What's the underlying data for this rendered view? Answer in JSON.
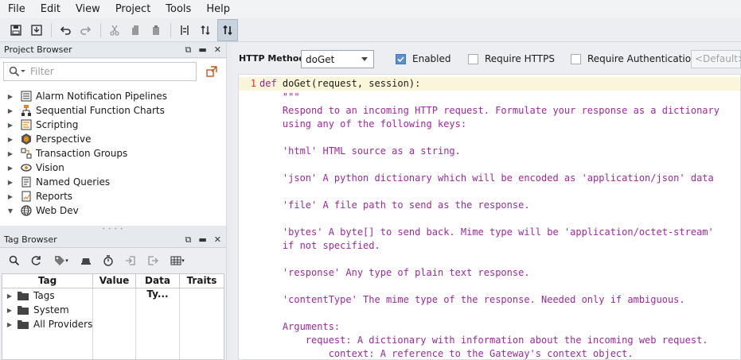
{
  "menu": [
    "File",
    "Edit",
    "View",
    "Project",
    "Tools",
    "Help"
  ],
  "project_browser": {
    "title": "Project Browser",
    "search_placeholder": "Filter",
    "items": [
      {
        "label": "Alarm Notification Pipelines",
        "icon": "pipeline-icon",
        "expanded": false
      },
      {
        "label": "Sequential Function Charts",
        "icon": "sfc-icon",
        "expanded": false
      },
      {
        "label": "Scripting",
        "icon": "script-icon",
        "expanded": false
      },
      {
        "label": "Perspective",
        "icon": "perspective-icon",
        "expanded": false
      },
      {
        "label": "Transaction Groups",
        "icon": "transaction-icon",
        "expanded": false
      },
      {
        "label": "Vision",
        "icon": "eye-icon",
        "expanded": false
      },
      {
        "label": "Named Queries",
        "icon": "query-icon",
        "expanded": false
      },
      {
        "label": "Reports",
        "icon": "report-icon",
        "expanded": false
      },
      {
        "label": "Web Dev",
        "icon": "globe-icon",
        "expanded": true
      }
    ]
  },
  "tag_browser": {
    "title": "Tag Browser",
    "columns": [
      "Tag",
      "Value",
      "Data Ty...",
      "Traits"
    ],
    "rows": [
      {
        "label": "Tags"
      },
      {
        "label": "System"
      },
      {
        "label": "All Providers"
      }
    ]
  },
  "editor": {
    "http_method_label": "HTTP Method",
    "http_method_value": "doGet",
    "enabled_label": "Enabled",
    "enabled_checked": true,
    "require_https_label": "Require HTTPS",
    "require_https_checked": false,
    "require_auth_label": "Require Authentication",
    "require_auth_checked": false,
    "default_placeholder": "<Default>",
    "line_number": "1",
    "code_lines": [
      "def doGet(request, session):",
      "    \"\"\"",
      "    Respond to an incoming HTTP request. Formulate your response as a dictionary",
      "    using any of the following keys:",
      "",
      "    'html' HTML source as a string.",
      "",
      "    'json' A python dictionary which will be encoded as 'application/json' data",
      "",
      "    'file' A file path to send as the response.",
      "",
      "    'bytes' A byte[] to send back. Mime type will be 'application/octet-stream'",
      "    if not specified.",
      "",
      "    'response' Any type of plain text response.",
      "",
      "    'contentType' The mime type of the response. Needed only if ambiguous.",
      "",
      "    Arguments:",
      "        request: A dictionary with information about the incoming web request.",
      "            context: A reference to the Gateway's context object."
    ]
  },
  "colors": {
    "keyword": "#a01f8a",
    "docstring": "#9a2b9a",
    "line_number": "#dd3333",
    "highlight_line": "#fbf6d9"
  }
}
